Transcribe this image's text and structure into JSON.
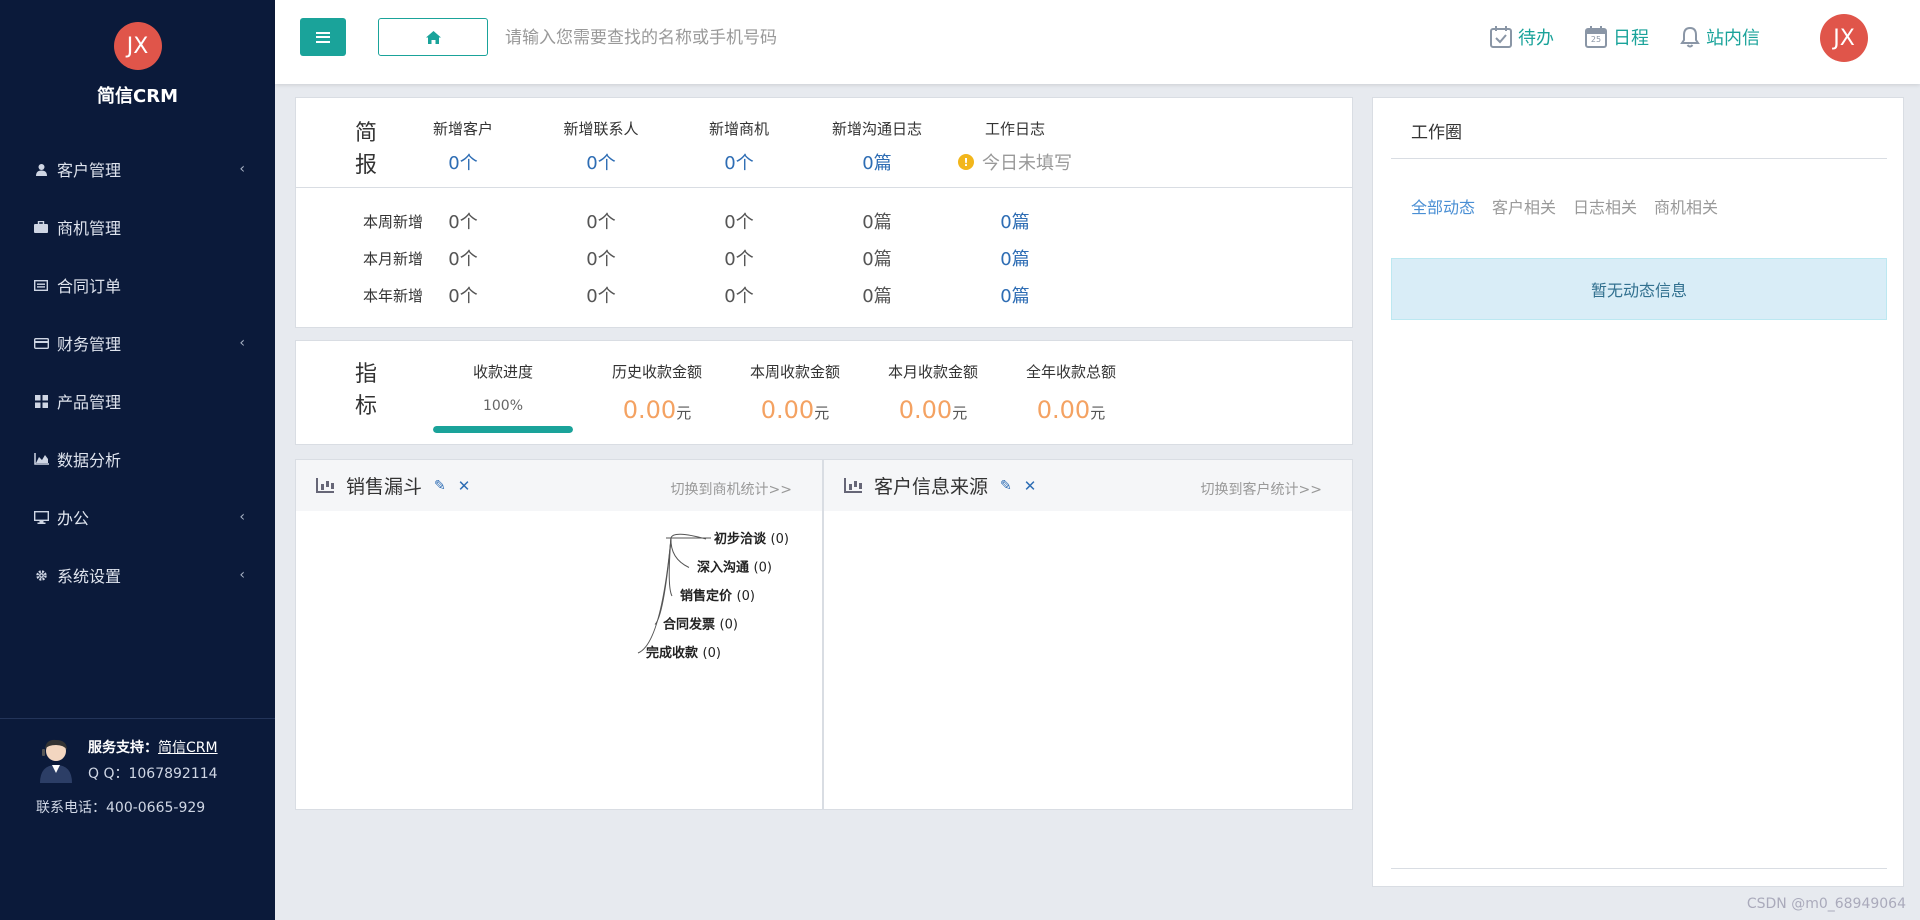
{
  "brand": {
    "logo": "JX",
    "name": "简信CRM"
  },
  "sidebar": {
    "items": [
      {
        "label": "客户管理",
        "icon": "user-icon",
        "chevron": "‹"
      },
      {
        "label": "商机管理",
        "icon": "briefcase-icon",
        "chevron": ""
      },
      {
        "label": "合同订单",
        "icon": "card-icon",
        "chevron": ""
      },
      {
        "label": "财务管理",
        "icon": "credit-card-icon",
        "chevron": "‹"
      },
      {
        "label": "产品管理",
        "icon": "grid-icon",
        "chevron": ""
      },
      {
        "label": "数据分析",
        "icon": "area-chart-icon",
        "chevron": ""
      },
      {
        "label": "办公",
        "icon": "desktop-icon",
        "chevron": "‹"
      },
      {
        "label": "系统设置",
        "icon": "gear-icon",
        "chevron": "‹"
      }
    ]
  },
  "support": {
    "title": "服务支持：",
    "link": "简信CRM",
    "qq": "Q Q：1067892114",
    "phone": "联系电话：400-0665-929"
  },
  "header": {
    "search_placeholder": "请输入您需要查找的名称或手机号码",
    "todo": "待办",
    "schedule": "日程",
    "calendar_day": "25",
    "messages": "站内信",
    "avatar": "JX"
  },
  "brief": {
    "title_line1": "简",
    "title_line2": "报",
    "columns": [
      {
        "head": "新增客户",
        "today": "0个"
      },
      {
        "head": "新增联系人",
        "today": "0个"
      },
      {
        "head": "新增商机",
        "today": "0个"
      },
      {
        "head": "新增沟通日志",
        "today": "0篇"
      },
      {
        "head": "工作日志",
        "today": "今日未填写"
      }
    ],
    "rows": [
      {
        "label": "本周新增",
        "values": [
          "0个",
          "0个",
          "0个",
          "0篇",
          "0篇"
        ]
      },
      {
        "label": "本月新增",
        "values": [
          "0个",
          "0个",
          "0个",
          "0篇",
          "0篇"
        ]
      },
      {
        "label": "本年新增",
        "values": [
          "0个",
          "0个",
          "0个",
          "0篇",
          "0篇"
        ]
      }
    ]
  },
  "index": {
    "title_line1": "指",
    "title_line2": "标",
    "progress": {
      "head": "收款进度",
      "pct_label": "100%",
      "value": 1.0
    },
    "amounts": [
      {
        "head": "历史收款金额",
        "value": "0.00",
        "unit": "元"
      },
      {
        "head": "本周收款金额",
        "value": "0.00",
        "unit": "元"
      },
      {
        "head": "本月收款金额",
        "value": "0.00",
        "unit": "元"
      },
      {
        "head": "全年收款总额",
        "value": "0.00",
        "unit": "元"
      }
    ]
  },
  "funnel": {
    "title": "销售漏斗",
    "switch": "切换到商机统计>>",
    "stages": [
      {
        "name": "初步洽谈",
        "count": "(0)"
      },
      {
        "name": "深入沟通",
        "count": "(0)"
      },
      {
        "name": "销售定价",
        "count": "(0)"
      },
      {
        "name": "合同发票",
        "count": "(0)"
      },
      {
        "name": "完成收款",
        "count": "(0)"
      }
    ]
  },
  "source": {
    "title": "客户信息来源",
    "switch": "切换到客户统计>>"
  },
  "work": {
    "title": "工作圈",
    "tabs": [
      "全部动态",
      "客户相关",
      "日志相关",
      "商机相关"
    ],
    "empty": "暂无动态信息"
  },
  "watermark": "CSDN @m0_68949064",
  "colors": {
    "sidebar": "#0b1a3a",
    "accent": "#1aa39a",
    "link": "#2e6db4",
    "amount": "#f4a262",
    "avatar": "#e0554a"
  }
}
